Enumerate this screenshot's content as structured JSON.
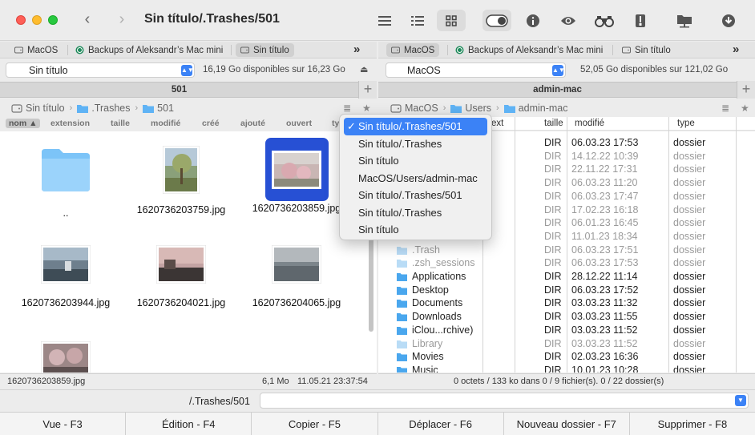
{
  "window": {
    "title": "Sin título/.Trashes/501"
  },
  "colors": {
    "accent": "#3b82f6",
    "folder": "#5fb3f5",
    "selection": "#2750d4"
  },
  "left": {
    "tabs": [
      {
        "label": "MacOS",
        "active": false
      },
      {
        "label": "Backups of Aleksandr’s Mac mini",
        "active": false
      },
      {
        "label": "Sin título",
        "active": true
      }
    ],
    "volume": "Sin título",
    "free_space": "16,19 Go disponibles sur 16,23 Go",
    "path_header": "501",
    "breadcrumb": [
      "Sin título",
      ".Trashes",
      "501"
    ],
    "columns": [
      "nom",
      "extension",
      "taille",
      "modifié",
      "créé",
      "ajouté",
      "ouvert",
      "ty"
    ],
    "items": [
      {
        "name": "..",
        "kind": "folder"
      },
      {
        "name": "1620736203759.jpg",
        "kind": "image"
      },
      {
        "name": "1620736203859.jpg",
        "kind": "image",
        "selected": true
      },
      {
        "name": "1620736203944.jpg",
        "kind": "image"
      },
      {
        "name": "1620736204021.jpg",
        "kind": "image"
      },
      {
        "name": "1620736204065.jpg",
        "kind": "image"
      },
      {
        "name": "",
        "kind": "image"
      }
    ],
    "status": {
      "name": "1620736203859.jpg",
      "size": "6,1 Mo",
      "date": "11.05.21 23:37:54"
    }
  },
  "right": {
    "tabs": [
      {
        "label": "MacOS",
        "active": true
      },
      {
        "label": "Backups of Aleksandr’s Mac mini",
        "active": false
      },
      {
        "label": "Sin título",
        "active": false
      }
    ],
    "volume": "MacOS",
    "free_space": "52,05 Go disponibles sur 121,02 Go",
    "path_header": "admin-mac",
    "breadcrumb": [
      "MacOS",
      "Users",
      "admin-mac"
    ],
    "columns": [
      "ext",
      "taille",
      "modifié",
      "type"
    ],
    "rows": [
      {
        "name": "",
        "size": "DIR",
        "modified": "06.03.23 17:53",
        "type": "dossier",
        "dim": false
      },
      {
        "name": "",
        "size": "DIR",
        "modified": "14.12.22 10:39",
        "type": "dossier",
        "dim": true
      },
      {
        "name": "",
        "size": "DIR",
        "modified": "22.11.22 17:31",
        "type": "dossier",
        "dim": true
      },
      {
        "name": "",
        "size": "DIR",
        "modified": "06.03.23 11:20",
        "type": "dossier",
        "dim": true
      },
      {
        "name": "",
        "size": "DIR",
        "modified": "06.03.23 17:47",
        "type": "dossier",
        "dim": true
      },
      {
        "name": "",
        "size": "DIR",
        "modified": "17.02.23 16:18",
        "type": "dossier",
        "dim": true
      },
      {
        "name": "",
        "size": "DIR",
        "modified": "06.01.23 16:45",
        "type": "dossier",
        "dim": true
      },
      {
        "name": "",
        "size": "DIR",
        "modified": "11.01.23 18:34",
        "type": "dossier",
        "dim": true
      },
      {
        "name": ".Trash",
        "size": "DIR",
        "modified": "06.03.23 17:51",
        "type": "dossier",
        "dim": true
      },
      {
        "name": ".zsh_sessions",
        "size": "DIR",
        "modified": "06.03.23 17:53",
        "type": "dossier",
        "dim": true
      },
      {
        "name": "Applications",
        "size": "DIR",
        "modified": "28.12.22 11:14",
        "type": "dossier",
        "dim": false
      },
      {
        "name": "Desktop",
        "size": "DIR",
        "modified": "06.03.23 17:52",
        "type": "dossier",
        "dim": false
      },
      {
        "name": "Documents",
        "size": "DIR",
        "modified": "03.03.23 11:32",
        "type": "dossier",
        "dim": false
      },
      {
        "name": "Downloads",
        "size": "DIR",
        "modified": "03.03.23 11:55",
        "type": "dossier",
        "dim": false
      },
      {
        "name": "iClou...rchive)",
        "size": "DIR",
        "modified": "03.03.23 11:52",
        "type": "dossier",
        "dim": false
      },
      {
        "name": "Library",
        "size": "DIR",
        "modified": "03.03.23 11:52",
        "type": "dossier",
        "dim": true
      },
      {
        "name": "Movies",
        "size": "DIR",
        "modified": "02.03.23 16:36",
        "type": "dossier",
        "dim": false
      },
      {
        "name": "Music",
        "size": "DIR",
        "modified": "10.01.23 10:28",
        "type": "dossier",
        "dim": false
      }
    ],
    "status": "0 octets / 133 ko dans 0 / 9 fichier(s). 0 / 22 dossier(s)"
  },
  "dropdown": {
    "items": [
      {
        "label": "Sin título/.Trashes/501",
        "checked": true
      },
      {
        "label": "Sin título/.Trashes",
        "checked": false
      },
      {
        "label": "Sin título",
        "checked": false
      },
      {
        "label": "MacOS/Users/admin-mac",
        "checked": false
      },
      {
        "label": "Sin título/.Trashes/501",
        "checked": false
      },
      {
        "label": "Sin título/.Trashes",
        "checked": false
      },
      {
        "label": "Sin título",
        "checked": false
      }
    ]
  },
  "command": {
    "path": "/.Trashes/501",
    "value": ""
  },
  "fkeys": [
    "Vue - F3",
    "Édition - F4",
    "Copier - F5",
    "Déplacer - F6",
    "Nouveau dossier - F7",
    "Supprimer - F8"
  ],
  "icons": {
    "more": "»",
    "plus": "+",
    "check": "✓",
    "back": "‹",
    "forward": "›",
    "eject": "⏏",
    "list": "≣",
    "star": "★"
  }
}
